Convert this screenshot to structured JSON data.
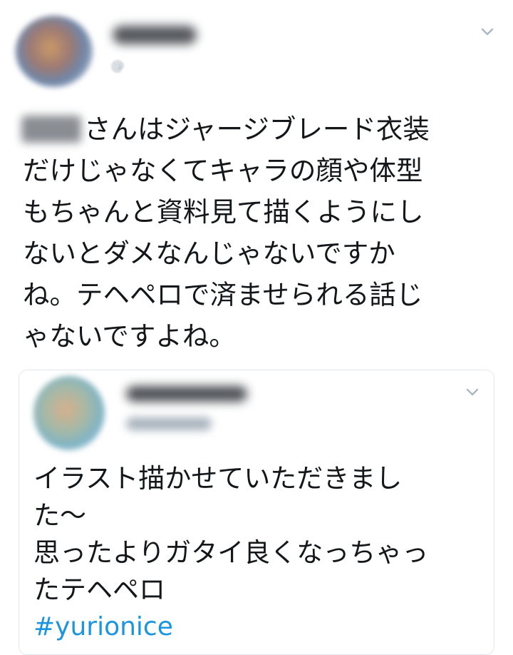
{
  "tweet": {
    "text": "さんはジャージブレード衣装\nだけじゃなくてキャラの顔や体型\nもちゃんと資料見て描くようにし\nないとダメなんじゃないですか\nね。テヘペロで済ませられる話じ\nゃないですよね。",
    "display_name": "",
    "handle": "@"
  },
  "quoted_tweet": {
    "text": "イラスト描かせていただきまし\nた〜\n思ったよりガタイ良くなっちゃっ\nたテヘペロ",
    "hashtag": "#yurionice"
  },
  "icons": {
    "tweet_menu": "chevron-down-icon",
    "quote_menu": "chevron-down-icon"
  },
  "colors": {
    "text": "#14171a",
    "secondary": "#8899a6",
    "link": "#1b95e0",
    "border": "#e1e8ed"
  }
}
